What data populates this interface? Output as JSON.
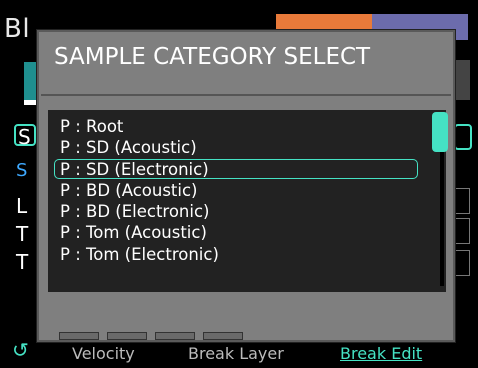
{
  "background": {
    "title": "Bl",
    "s_box_letter": "S",
    "s_blue_letter": "S",
    "letters": [
      "L",
      "T",
      "T"
    ],
    "velocity_label": "Velocity",
    "layer_label": "Break Layer",
    "edit_label": "Break Edit"
  },
  "dialog": {
    "title": "SAMPLE CATEGORY SELECT",
    "items": [
      {
        "label": "P : Root"
      },
      {
        "label": "P : SD (Acoustic)"
      },
      {
        "label": "P : SD (Electronic)"
      },
      {
        "label": "P : BD (Acoustic)"
      },
      {
        "label": "P : BD (Electronic)"
      },
      {
        "label": "P : Tom (Acoustic)"
      },
      {
        "label": "P : Tom (Electronic)"
      }
    ],
    "selected_index": 2
  },
  "colors": {
    "accent": "#45e2c4",
    "dialog_bg": "#7f7f7f",
    "list_bg": "#222222"
  }
}
